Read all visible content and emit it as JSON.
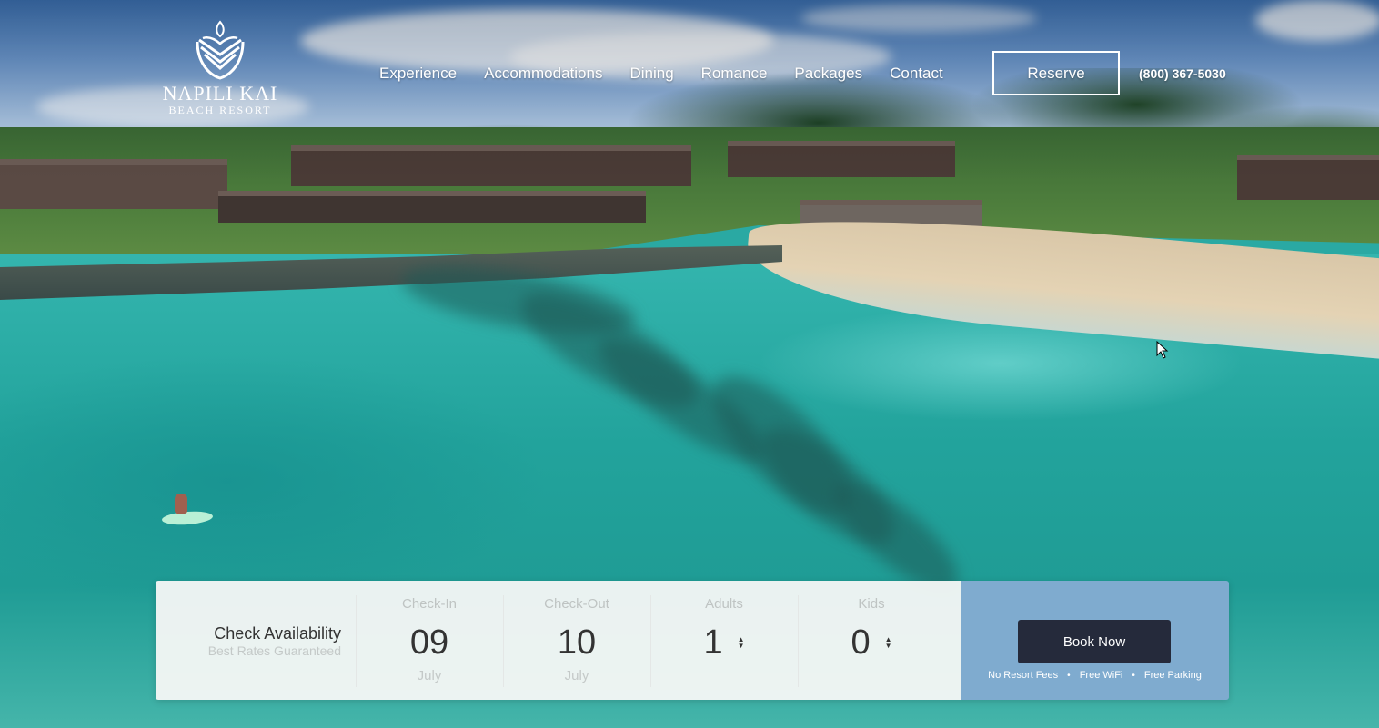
{
  "brand": {
    "name": "NAPILI KAI",
    "tagline": "BEACH RESORT"
  },
  "nav": {
    "items": [
      {
        "label": "Experience"
      },
      {
        "label": "Accommodations"
      },
      {
        "label": "Dining"
      },
      {
        "label": "Romance"
      },
      {
        "label": "Packages"
      },
      {
        "label": "Contact"
      }
    ],
    "reserve_label": "Reserve",
    "phone": "(800) 367-5030"
  },
  "booking": {
    "title": "Check Availability",
    "subtitle": "Best Rates Guaranteed",
    "checkin": {
      "label": "Check-In",
      "day": "09",
      "month": "July"
    },
    "checkout": {
      "label": "Check-Out",
      "day": "10",
      "month": "July"
    },
    "adults": {
      "label": "Adults",
      "value": "1"
    },
    "kids": {
      "label": "Kids",
      "value": "0"
    },
    "book_label": "Book Now",
    "perks": [
      "No Resort Fees",
      "Free WiFi",
      "Free Parking"
    ],
    "cta_color": "#7fabcf",
    "button_color": "#252a3b"
  },
  "icons": {
    "logo": "lotus-leaf-logo-icon",
    "spin": "up-down-arrows-icon",
    "cursor": "mouse-pointer-icon"
  }
}
